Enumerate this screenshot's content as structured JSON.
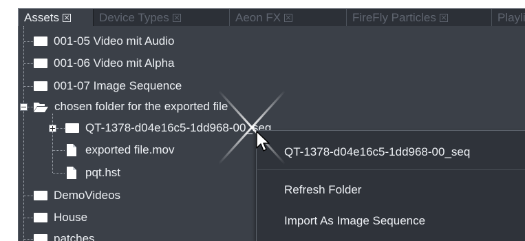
{
  "tabs": [
    {
      "label": "Assets",
      "active": true
    },
    {
      "label": "Device Types",
      "active": false
    },
    {
      "label": "Aeon FX",
      "active": false
    },
    {
      "label": "FireFly Particles",
      "active": false
    },
    {
      "label": "Playli",
      "active": false
    }
  ],
  "tree": {
    "items": [
      {
        "label": "001-05 Video mit Audio",
        "icon": "folder-icon"
      },
      {
        "label": "001-06 Video mit Alpha",
        "icon": "folder-icon"
      },
      {
        "label": "001-07 Image Sequence",
        "icon": "folder-icon"
      },
      {
        "label": "chosen folder for the exported file",
        "icon": "folder-open-icon",
        "expanded": true
      },
      {
        "label": "QT-1378-d04e16c5-1dd968-00_seq",
        "icon": "folder-icon",
        "expanded": false
      },
      {
        "label": "exported file.mov",
        "icon": "file-icon"
      },
      {
        "label": "pqt.hst",
        "icon": "file-icon"
      },
      {
        "label": "DemoVideos",
        "icon": "folder-icon"
      },
      {
        "label": "House",
        "icon": "folder-icon"
      },
      {
        "label": "patches",
        "icon": "folder-icon"
      }
    ]
  },
  "context_menu": {
    "header": "QT-1378-d04e16c5-1dd968-00_seq",
    "items": [
      {
        "label": "Refresh Folder"
      },
      {
        "label": "Import As Image Sequence"
      }
    ]
  },
  "colors": {
    "panel_background": "#3b4048",
    "tab_strip": "#2c3037",
    "menu_background": "#2f333a",
    "text": "#eef1f5",
    "inactive_tab_text": "#5f6570"
  }
}
